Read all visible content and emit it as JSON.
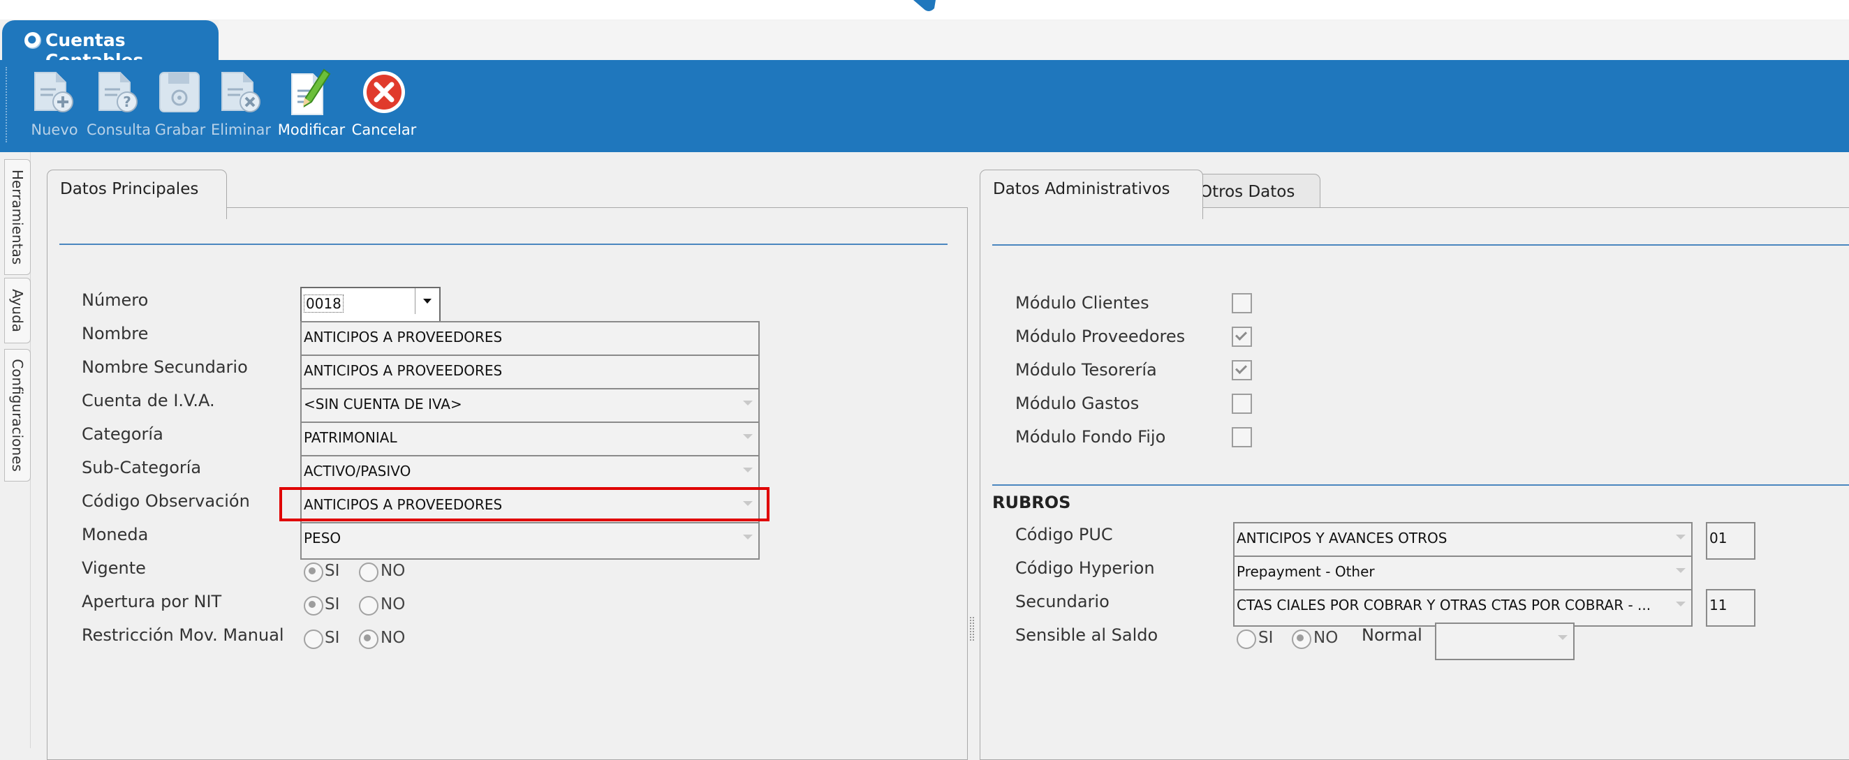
{
  "window": {
    "title": "Cuentas Contables",
    "icon": "app-logo-icon"
  },
  "toolbar": {
    "buttons": [
      {
        "label": "Nuevo",
        "icon": "new-document-icon",
        "enabled": false
      },
      {
        "label": "Consulta",
        "icon": "query-document-icon",
        "enabled": false
      },
      {
        "label": "Grabar",
        "icon": "save-disk-icon",
        "enabled": false
      },
      {
        "label": "Eliminar",
        "icon": "delete-document-icon",
        "enabled": false
      },
      {
        "label": "Modificar",
        "icon": "edit-document-icon",
        "enabled": true
      },
      {
        "label": "Cancelar",
        "icon": "cancel-icon",
        "enabled": true
      }
    ]
  },
  "side_tabs": [
    "Herramientas",
    "Ayuda",
    "Configuraciones"
  ],
  "left_panel": {
    "tab": "Datos Principales",
    "fields": {
      "numero": {
        "label": "Número",
        "value": "0018"
      },
      "nombre": {
        "label": "Nombre",
        "value": "ANTICIPOS A PROVEEDORES"
      },
      "nombre_secundario": {
        "label": "Nombre Secundario",
        "value": "ANTICIPOS A PROVEEDORES"
      },
      "cuenta_iva": {
        "label": "Cuenta de I.V.A.",
        "value": "<SIN CUENTA DE IVA>"
      },
      "categoria": {
        "label": "Categoría",
        "value": "PATRIMONIAL"
      },
      "sub_categoria": {
        "label": "Sub-Categoría",
        "value": "ACTIVO/PASIVO"
      },
      "codigo_observacion": {
        "label": "Código Observación",
        "value": "ANTICIPOS A PROVEEDORES"
      },
      "moneda": {
        "label": "Moneda",
        "value": "PESO"
      }
    },
    "radios": {
      "si_label": "SI",
      "no_label": "NO",
      "vigente": {
        "label": "Vigente",
        "selected": "SI"
      },
      "apertura_nit": {
        "label": "Apertura por NIT",
        "selected": "SI"
      },
      "restriccion": {
        "label": "Restricción Mov. Manual",
        "selected": "NO"
      }
    }
  },
  "right_panel": {
    "tabs": [
      "Datos Administrativos",
      "Otros Datos"
    ],
    "active_tab": "Datos Administrativos",
    "modules": [
      {
        "label": "Módulo Clientes",
        "checked": false
      },
      {
        "label": "Módulo Proveedores",
        "checked": true
      },
      {
        "label": "Módulo Tesorería",
        "checked": true
      },
      {
        "label": "Módulo Gastos",
        "checked": false
      },
      {
        "label": "Módulo Fondo Fijo",
        "checked": false
      }
    ],
    "rubros": {
      "heading": "RUBROS",
      "codigo_puc": {
        "label": "Código PUC",
        "value": "ANTICIPOS Y AVANCES OTROS",
        "code": "01"
      },
      "codigo_hyperion": {
        "label": "Código Hyperion",
        "value": "Prepayment - Other"
      },
      "secundario": {
        "label": "Secundario",
        "value": "CTAS CIALES POR COBRAR Y OTRAS CTAS POR COBRAR - ...",
        "code": "11"
      },
      "sensible_saldo": {
        "label": "Sensible al Saldo",
        "selected": "NO",
        "si_label": "SI",
        "no_label": "NO"
      },
      "normal": {
        "label": "Normal",
        "value": ""
      }
    }
  },
  "colors": {
    "accent": "#1f77bd",
    "highlight": "#e00000"
  }
}
